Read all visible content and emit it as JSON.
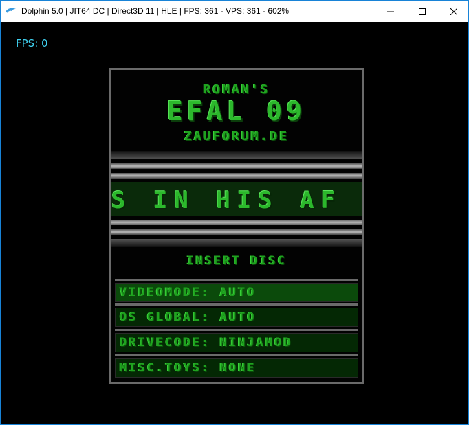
{
  "window": {
    "title": "Dolphin 5.0 | JIT64 DC | Direct3D 11 | HLE | FPS: 361 - VPS: 361 - 602%",
    "app_icon": "dolphin-icon",
    "controls": {
      "minimize_icon": "minimize-icon",
      "maximize_icon": "maximize-icon",
      "close_icon": "close-icon"
    },
    "frame_color": "#1883d7"
  },
  "overlay": {
    "fps_text": "FPS: 0",
    "color": "#3fd0ef"
  },
  "menu": {
    "title_line1": "ROMAN'S",
    "title_line2": "EFAL 09",
    "title_line3": "ZAUFORUM.DE",
    "scroller_text": "S IN HIS AF",
    "insert_disc": "INSERT DISC",
    "options": [
      {
        "label": "VIDEOMODE: AUTO"
      },
      {
        "label": "OS GLOBAL: AUTO"
      },
      {
        "label": "DRIVECODE: NINJAMOD"
      },
      {
        "label": "MISC.TOYS: NONE"
      }
    ],
    "accent_color": "#1fa31f"
  }
}
